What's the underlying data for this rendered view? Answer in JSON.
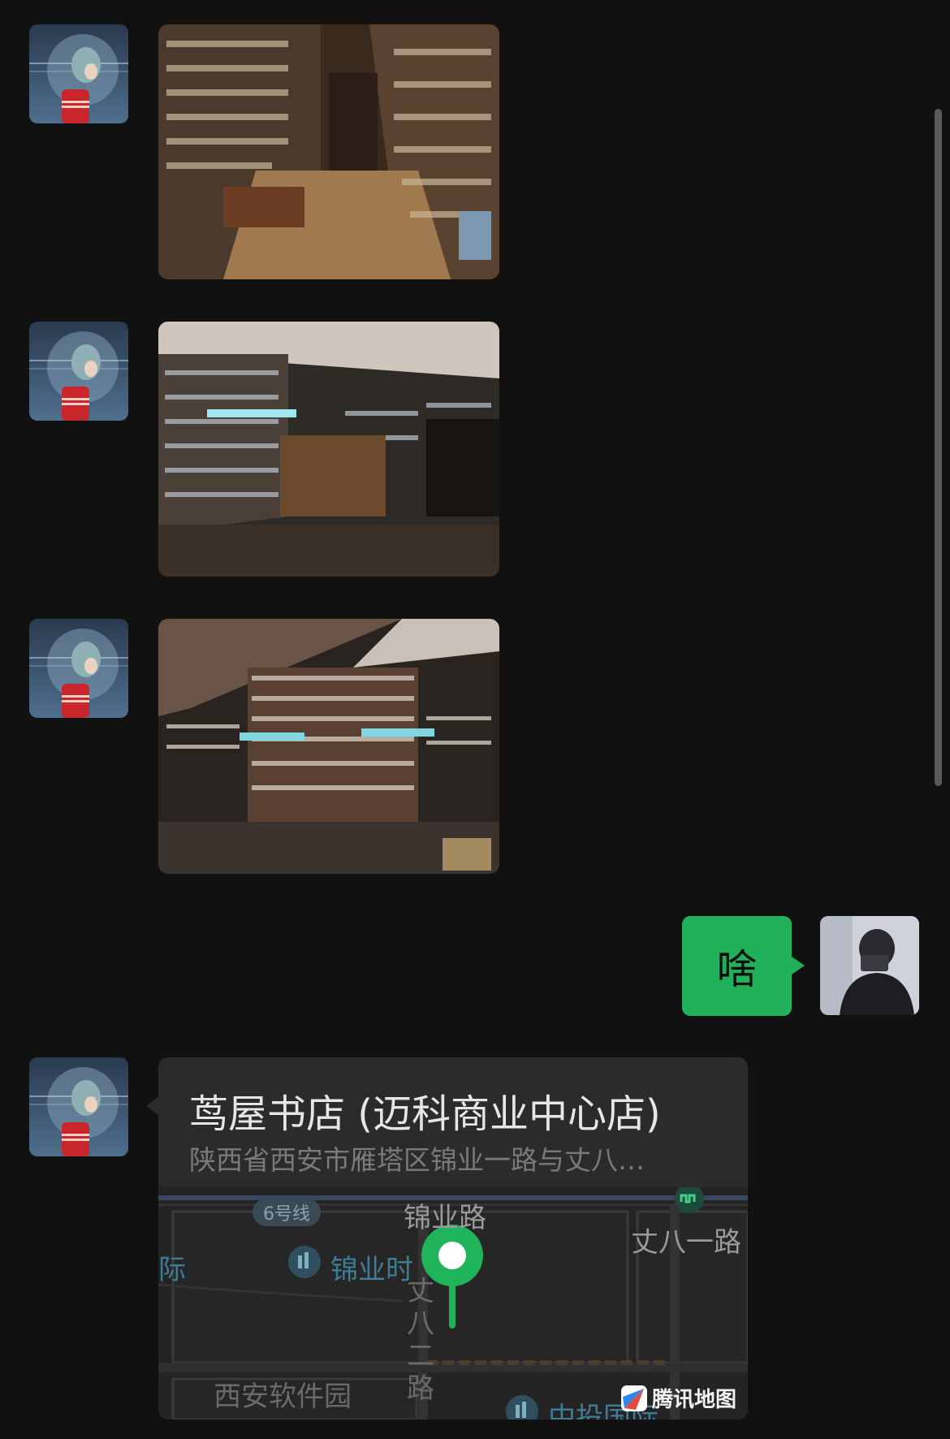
{
  "messages": {
    "outgoing_text": "啥"
  },
  "location": {
    "name": "茑屋书店 (迈科商业中心店)",
    "address": "陕西省西安市雁塔区锦业一路与丈八…",
    "map": {
      "road_north": "锦业路",
      "road_east": "丈八一路",
      "road_vertical": "丈八二路",
      "metro_badge": "6号线",
      "poi_left_fragment": "际",
      "poi_jinye": "锦业时",
      "poi_software_park": "西安软件园",
      "poi_zhongtou": "中投国际",
      "credit": "腾讯地图"
    }
  },
  "colors": {
    "background": "#111111",
    "outgoing_bubble": "#21b15a",
    "card": "#2b2b2b",
    "pin": "#1fb35a"
  }
}
